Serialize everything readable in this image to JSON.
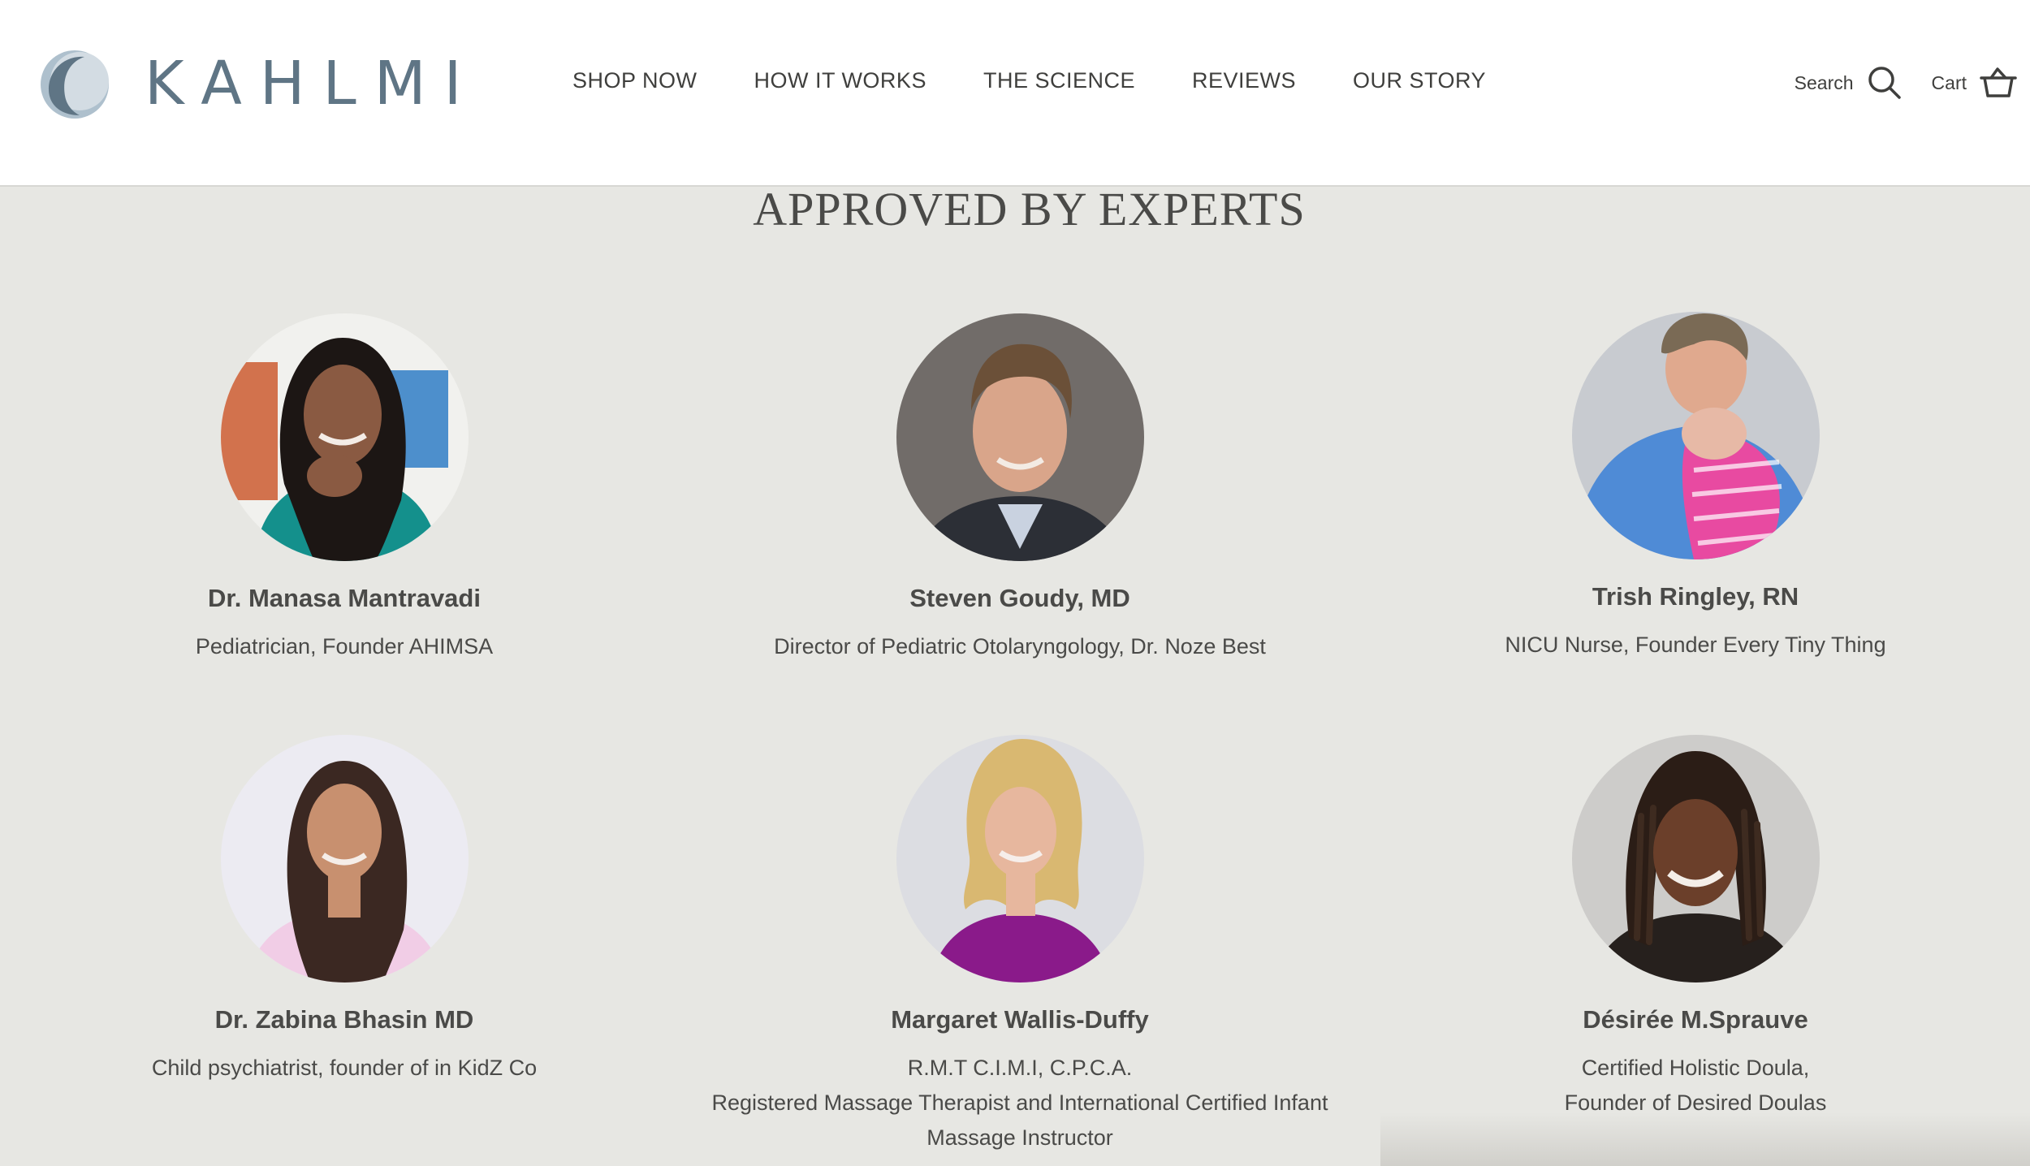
{
  "brand": {
    "name": "KAHLMI"
  },
  "nav": {
    "items": [
      "SHOP NOW",
      "HOW IT WORKS",
      "THE SCIENCE",
      "REVIEWS",
      "OUR STORY"
    ]
  },
  "tools": {
    "search_label": "Search",
    "cart_label": "Cart"
  },
  "section": {
    "title": "APPROVED BY EXPERTS"
  },
  "experts": [
    {
      "name": "Dr. Manasa Mantravadi",
      "role_lines": [
        "Pediatrician, Founder AHIMSA"
      ]
    },
    {
      "name": "Steven Goudy, MD",
      "role_lines": [
        "Director of Pediatric Otolaryngology, Dr. Noze Best"
      ]
    },
    {
      "name": "Trish Ringley, RN",
      "role_lines": [
        "NICU Nurse, Founder Every Tiny Thing"
      ]
    },
    {
      "name": "Dr. Zabina Bhasin MD",
      "role_lines": [
        "Child psychiatrist, founder of in KidZ Co"
      ]
    },
    {
      "name": "Margaret Wallis-Duffy",
      "role_lines": [
        "R.M.T C.I.M.I, C.P.C.A.",
        "Registered Massage Therapist and International Certified Infant",
        "Massage Instructor"
      ]
    },
    {
      "name": "Désirée M.Sprauve",
      "role_lines": [
        "Certified Holistic Doula,",
        "Founder of Desired Doulas"
      ]
    }
  ]
}
